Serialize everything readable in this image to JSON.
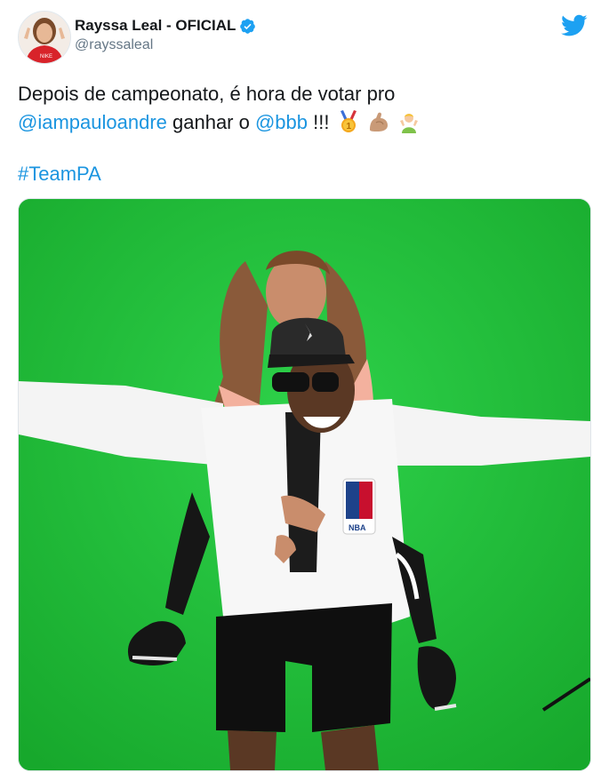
{
  "account": {
    "display_name": "Rayssa Leal - OFICIAL",
    "handle": "@rayssaleal",
    "verified": true
  },
  "tweet": {
    "line1_text": "Depois de campeonato, é hora de votar pro",
    "mention1": "@iampauloandre",
    "middle_text": " ganhar o ",
    "mention2": "@bbb",
    "exclaim": " !!!",
    "hashtag": "#TeamPA",
    "emojis": [
      "first-place-medal",
      "flexed-biceps",
      "person-raising-hand"
    ]
  },
  "media": {
    "description": "Photo on green screen",
    "logo_text": "NBA"
  },
  "colors": {
    "link": "#1b95e0",
    "twitter_blue": "#1da1f2",
    "green_screen": "#1fbf36",
    "text": "#14171a",
    "secondary_text": "#657786"
  }
}
